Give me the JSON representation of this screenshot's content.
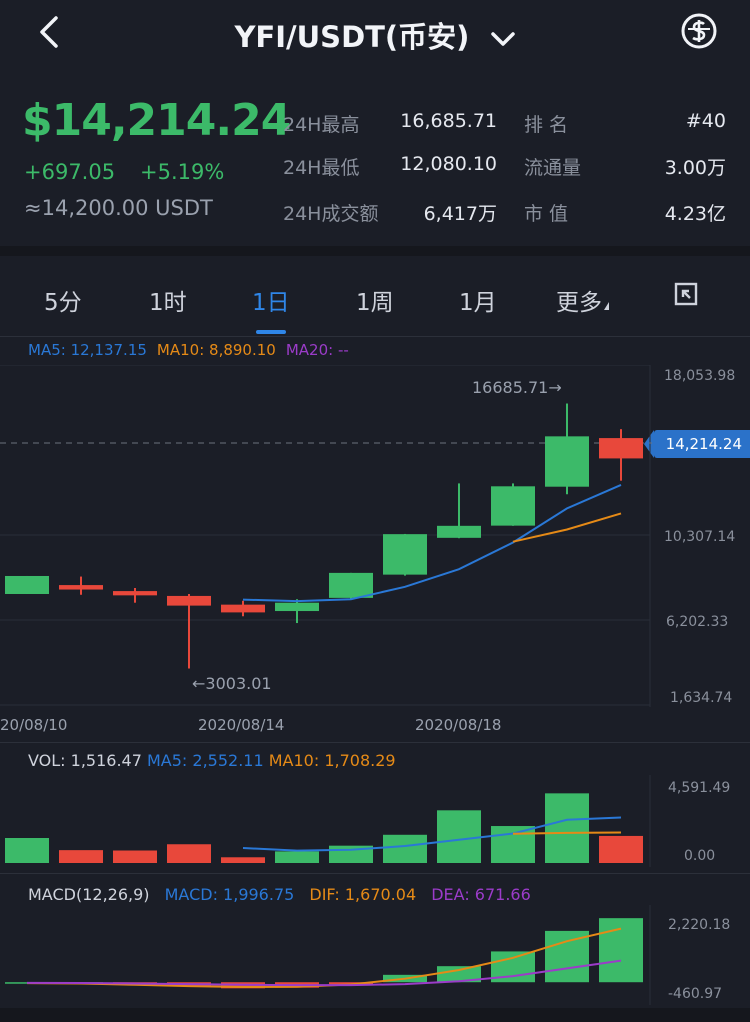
{
  "nav": {
    "title": "YFI/USDT(币安)"
  },
  "header": {
    "price": "$14,214.24",
    "change": "+697.05",
    "change_pct": "+5.19%",
    "approx": "≈14,200.00 USDT",
    "stats": [
      {
        "label": "24H最高",
        "value": "16,685.71"
      },
      {
        "label": "24H最低",
        "value": "12,080.10"
      },
      {
        "label": "24H成交额",
        "value": "6,417万"
      },
      {
        "label": "排 名",
        "value": "#40"
      },
      {
        "label": "流通量",
        "value": "3.00万"
      },
      {
        "label": "市 值",
        "value": "4.23亿"
      }
    ]
  },
  "tabs": [
    {
      "label": "5分"
    },
    {
      "label": "1时"
    },
    {
      "label": "1日",
      "active": true
    },
    {
      "label": "1周"
    },
    {
      "label": "1月"
    },
    {
      "label": "更多"
    }
  ],
  "ma": {
    "ma5": "MA5: 12,137.15",
    "ma10": "MA10: 8,890.10",
    "ma20": "MA20: --"
  },
  "price_axis": [
    "18,053.98",
    "10,307.14",
    "6,202.33",
    "1,634.74"
  ],
  "current_price_tag": "14,214.24",
  "annotations": {
    "high": "16685.71→",
    "low": "←3003.01"
  },
  "date_axis": [
    "20/08/10",
    "2020/08/14",
    "2020/08/18"
  ],
  "vol": {
    "label": "VOL: 1,516.47",
    "ma5": "MA5: 2,552.11",
    "ma10": "MA10: 1,708.29",
    "axis": [
      "4,591.49",
      "0.00"
    ]
  },
  "macd": {
    "label": "MACD(12,26,9)",
    "macd": "MACD: 1,996.75",
    "dif": "DIF: 1,670.04",
    "dea": "DEA: 671.66",
    "axis": [
      "2,220.18",
      "-460.97"
    ]
  },
  "colors": {
    "up": "#3cba69",
    "down": "#e8483b",
    "ma5": "#2a78d6",
    "ma10": "#e58a17",
    "ma20": "#9b3cc9",
    "accent": "#2f86e8"
  },
  "chart_data": {
    "type": "candlestick",
    "series_ohlc": [
      {
        "o": 6850,
        "h": 7610,
        "l": 6850,
        "c": 7780
      },
      {
        "o": 7310,
        "h": 7750,
        "l": 6810,
        "c": 7080
      },
      {
        "o": 7000,
        "h": 7160,
        "l": 6400,
        "c": 6780
      },
      {
        "o": 6750,
        "h": 6850,
        "l": 3003,
        "c": 6250
      },
      {
        "o": 6300,
        "h": 6500,
        "l": 5700,
        "c": 5900
      },
      {
        "o": 5970,
        "h": 6580,
        "l": 5350,
        "c": 6400
      },
      {
        "o": 6650,
        "h": 7900,
        "l": 6590,
        "c": 7940
      },
      {
        "o": 7850,
        "h": 9950,
        "l": 7800,
        "c": 9940
      },
      {
        "o": 9750,
        "h": 12560,
        "l": 9730,
        "c": 10370
      },
      {
        "o": 10380,
        "h": 12560,
        "l": 10370,
        "c": 12410
      },
      {
        "o": 12390,
        "h": 16685,
        "l": 12000,
        "c": 14990
      },
      {
        "o": 14900,
        "h": 15360,
        "l": 12700,
        "c": 13850
      }
    ],
    "ma5_line": [
      null,
      null,
      null,
      null,
      6560,
      6480,
      6580,
      7220,
      8130,
      9510,
      11270,
      12480
    ],
    "ma10_line": [
      null,
      null,
      null,
      null,
      null,
      null,
      null,
      null,
      null,
      9550,
      10180,
      11010
    ],
    "volume": [
      1400,
      720,
      700,
      1050,
      320,
      650,
      970,
      1580,
      2950,
      2070,
      3900,
      1516
    ],
    "vol_ma5": [
      null,
      null,
      null,
      null,
      840,
      690,
      740,
      950,
      1300,
      1650,
      2420,
      2550
    ],
    "vol_ma10": [
      null,
      null,
      null,
      null,
      null,
      null,
      null,
      null,
      null,
      1640,
      1690,
      1710
    ],
    "macd_hist": [
      0,
      0,
      -40,
      -130,
      -190,
      -170,
      -60,
      230,
      500,
      960,
      1600,
      1997
    ],
    "dif_line": [
      -30,
      -40,
      -80,
      -120,
      -150,
      -140,
      -70,
      110,
      380,
      760,
      1280,
      1670
    ],
    "dea_line": [
      -20,
      -25,
      -40,
      -60,
      -80,
      -90,
      -90,
      -60,
      30,
      190,
      430,
      672
    ],
    "ylim_price": [
      1634.74,
      18053.98
    ],
    "ylim_vol": [
      0,
      4591.49
    ],
    "ylim_macd": [
      -460.97,
      2220.18
    ]
  }
}
